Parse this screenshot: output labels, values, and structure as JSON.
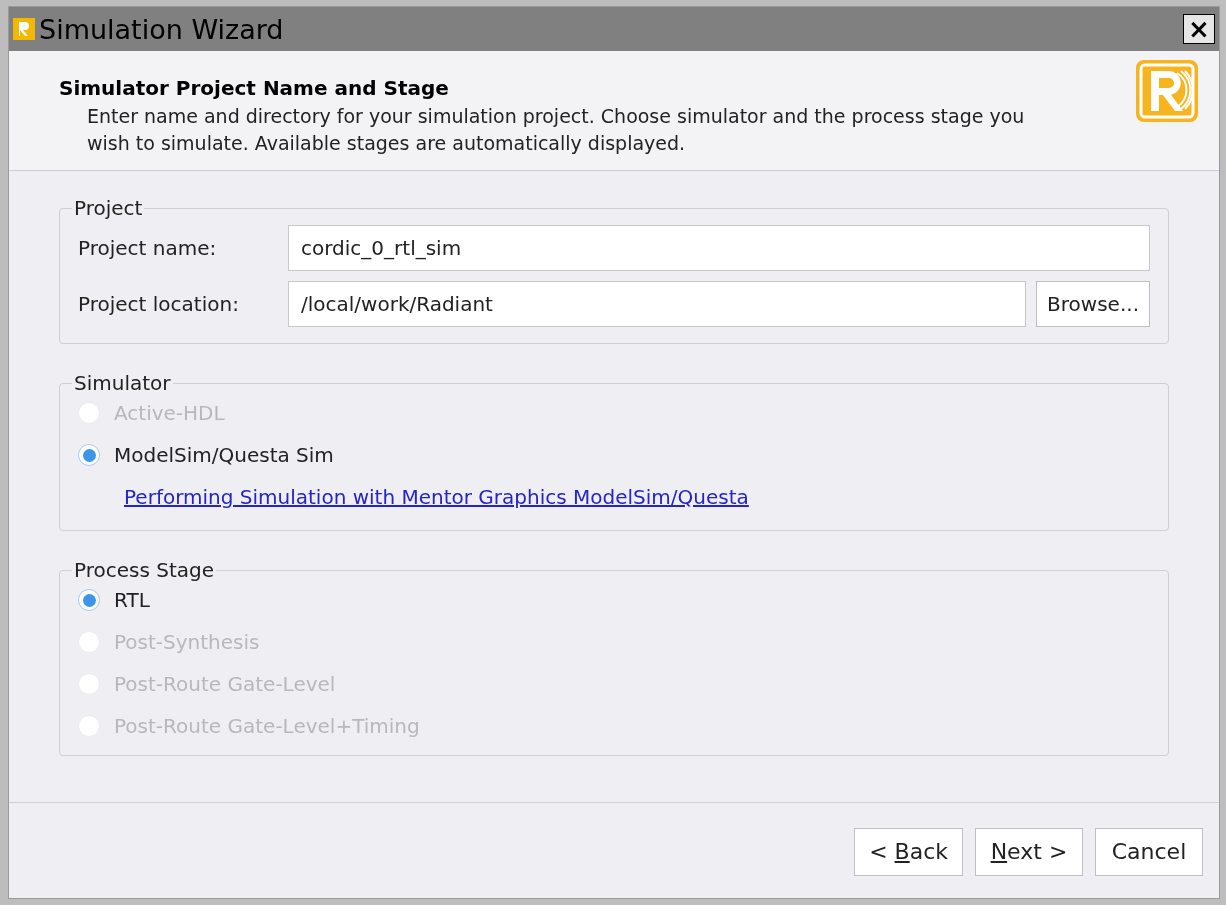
{
  "window": {
    "title": "Simulation Wizard",
    "close": "×"
  },
  "header": {
    "title": "Simulator Project Name and Stage",
    "description": "Enter name and directory for your simulation project. Choose simulator and the process stage you wish to simulate. Available stages are automatically displayed."
  },
  "project": {
    "legend": "Project",
    "name_label": "Project name:",
    "name_value": "cordic_0_rtl_sim",
    "location_label": "Project location:",
    "location_value": "/local/work/Radiant",
    "browse": "Browse..."
  },
  "simulator": {
    "legend": "Simulator",
    "options": [
      {
        "label": "Active-HDL",
        "selected": false,
        "disabled": true
      },
      {
        "label": "ModelSim/Questa Sim",
        "selected": true,
        "disabled": false
      }
    ],
    "link": "Performing Simulation with Mentor Graphics ModelSim/Questa"
  },
  "process_stage": {
    "legend": "Process Stage",
    "options": [
      {
        "label": "RTL",
        "selected": true,
        "disabled": false
      },
      {
        "label": "Post-Synthesis",
        "selected": false,
        "disabled": true
      },
      {
        "label": "Post-Route Gate-Level",
        "selected": false,
        "disabled": true
      },
      {
        "label": "Post-Route Gate-Level+Timing",
        "selected": false,
        "disabled": true
      }
    ]
  },
  "buttons": [
    {
      "before": "< ",
      "mnemonic": "B",
      "after": "ack"
    },
    {
      "mnemonic": "N",
      "after": "ext >"
    },
    {
      "before": "Cancel"
    }
  ]
}
